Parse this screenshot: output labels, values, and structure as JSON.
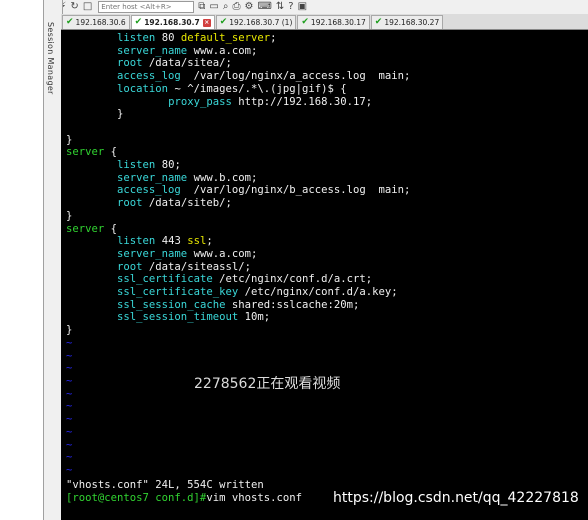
{
  "toolbar": {
    "host_placeholder": "Enter host <Alt+R>"
  },
  "side_panel": {
    "label": "Session Manager"
  },
  "tabs": [
    {
      "label": "192.168.30.6",
      "active": false,
      "closable": false
    },
    {
      "label": "192.168.30.7",
      "active": true,
      "closable": true
    },
    {
      "label": "192.168.30.7 (1)",
      "active": false,
      "closable": false
    },
    {
      "label": "192.168.30.17",
      "active": false,
      "closable": false
    },
    {
      "label": "192.168.30.27",
      "active": false,
      "closable": false
    }
  ],
  "terminal": {
    "lines": [
      [
        [
          "        ",
          "w"
        ],
        [
          "listen",
          "c"
        ],
        [
          " 80 ",
          "w"
        ],
        [
          "default_server",
          "y"
        ],
        [
          ";",
          "w"
        ]
      ],
      [
        [
          "        ",
          "w"
        ],
        [
          "server_name",
          "c"
        ],
        [
          " www.a.com;",
          "w"
        ]
      ],
      [
        [
          "        ",
          "w"
        ],
        [
          "root",
          "c"
        ],
        [
          " /data/sitea/;",
          "w"
        ]
      ],
      [
        [
          "        ",
          "w"
        ],
        [
          "access_log",
          "c"
        ],
        [
          "  /var/log/nginx/a_access.log  main;",
          "w"
        ]
      ],
      [
        [
          "        ",
          "w"
        ],
        [
          "location",
          "c"
        ],
        [
          " ~ ^/images/.*\\.(jpg|gif)$ {",
          "w"
        ]
      ],
      [
        [
          "                ",
          "w"
        ],
        [
          "proxy_pass",
          "c"
        ],
        [
          " http://192.168.30.17;",
          "w"
        ]
      ],
      [
        [
          "        }",
          "w"
        ]
      ],
      [
        [
          "",
          "w"
        ]
      ],
      [
        [
          "}",
          "w"
        ]
      ],
      [
        [
          "server",
          "g"
        ],
        [
          " {",
          "w"
        ]
      ],
      [
        [
          "        ",
          "w"
        ],
        [
          "listen",
          "c"
        ],
        [
          " 80;",
          "w"
        ]
      ],
      [
        [
          "        ",
          "w"
        ],
        [
          "server_name",
          "c"
        ],
        [
          " www.b.com;",
          "w"
        ]
      ],
      [
        [
          "        ",
          "w"
        ],
        [
          "access_log",
          "c"
        ],
        [
          "  /var/log/nginx/b_access.log  main;",
          "w"
        ]
      ],
      [
        [
          "        ",
          "w"
        ],
        [
          "root",
          "c"
        ],
        [
          " /data/siteb/;",
          "w"
        ]
      ],
      [
        [
          "}",
          "w"
        ]
      ],
      [
        [
          "server",
          "g"
        ],
        [
          " {",
          "w"
        ]
      ],
      [
        [
          "        ",
          "w"
        ],
        [
          "listen",
          "c"
        ],
        [
          " 443 ",
          "w"
        ],
        [
          "ssl",
          "y"
        ],
        [
          ";",
          "w"
        ]
      ],
      [
        [
          "        ",
          "w"
        ],
        [
          "server_name",
          "c"
        ],
        [
          " www.a.com;",
          "w"
        ]
      ],
      [
        [
          "        ",
          "w"
        ],
        [
          "root",
          "c"
        ],
        [
          " /data/siteassl/;",
          "w"
        ]
      ],
      [
        [
          "        ",
          "w"
        ],
        [
          "ssl_certificate",
          "c"
        ],
        [
          " /etc/nginx/conf.d/a.crt;",
          "w"
        ]
      ],
      [
        [
          "        ",
          "w"
        ],
        [
          "ssl_certificate_key",
          "c"
        ],
        [
          " /etc/nginx/conf.d/a.key;",
          "w"
        ]
      ],
      [
        [
          "        ",
          "w"
        ],
        [
          "ssl_session_cache",
          "c"
        ],
        [
          " shared:sslcache:20m;",
          "w"
        ]
      ],
      [
        [
          "        ",
          "w"
        ],
        [
          "ssl_session_timeout",
          "c"
        ],
        [
          " 10m;",
          "w"
        ]
      ],
      [
        [
          "}",
          "w"
        ]
      ]
    ],
    "tilde_count": 11,
    "status": "\"vhosts.conf\" 24L, 554C written",
    "prompt": "[root@centos7 conf.d]#",
    "command": "vim vhosts.conf"
  },
  "overlays": {
    "viewer_watermark": "2278562正在观看视频",
    "csdn_watermark": "https://blog.csdn.net/qq_42227818"
  }
}
